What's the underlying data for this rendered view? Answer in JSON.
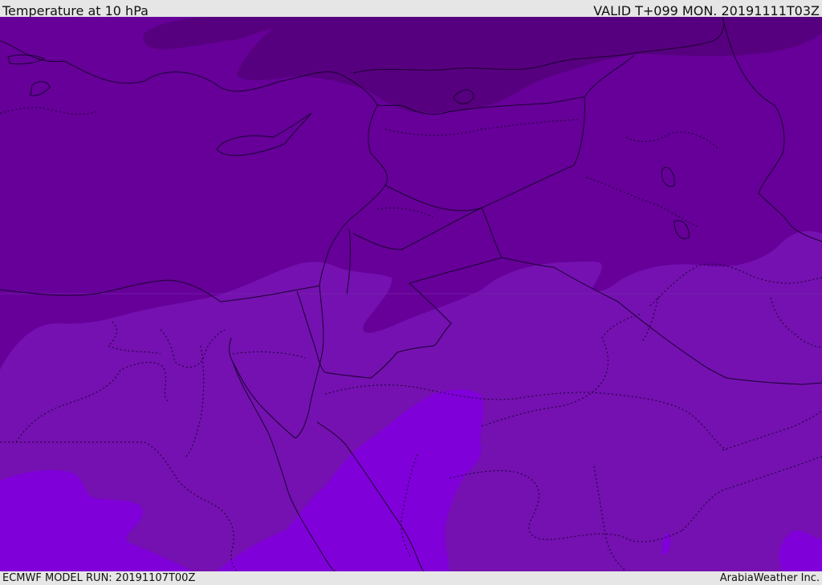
{
  "header": {
    "title": "Temperature at 10 hPa",
    "valid_time": "VALID T+099 MON. 20191111T03Z"
  },
  "footer": {
    "model_run": "ECMWF MODEL RUN: 20191107T00Z",
    "credit": "ArabiaWeather Inc."
  },
  "map": {
    "colors": {
      "band_darkest": "#57007f",
      "band_dark": "#660099",
      "band_mid": "#7411b0",
      "band_light": "#8000d9",
      "border_line": "#1a0030"
    }
  }
}
